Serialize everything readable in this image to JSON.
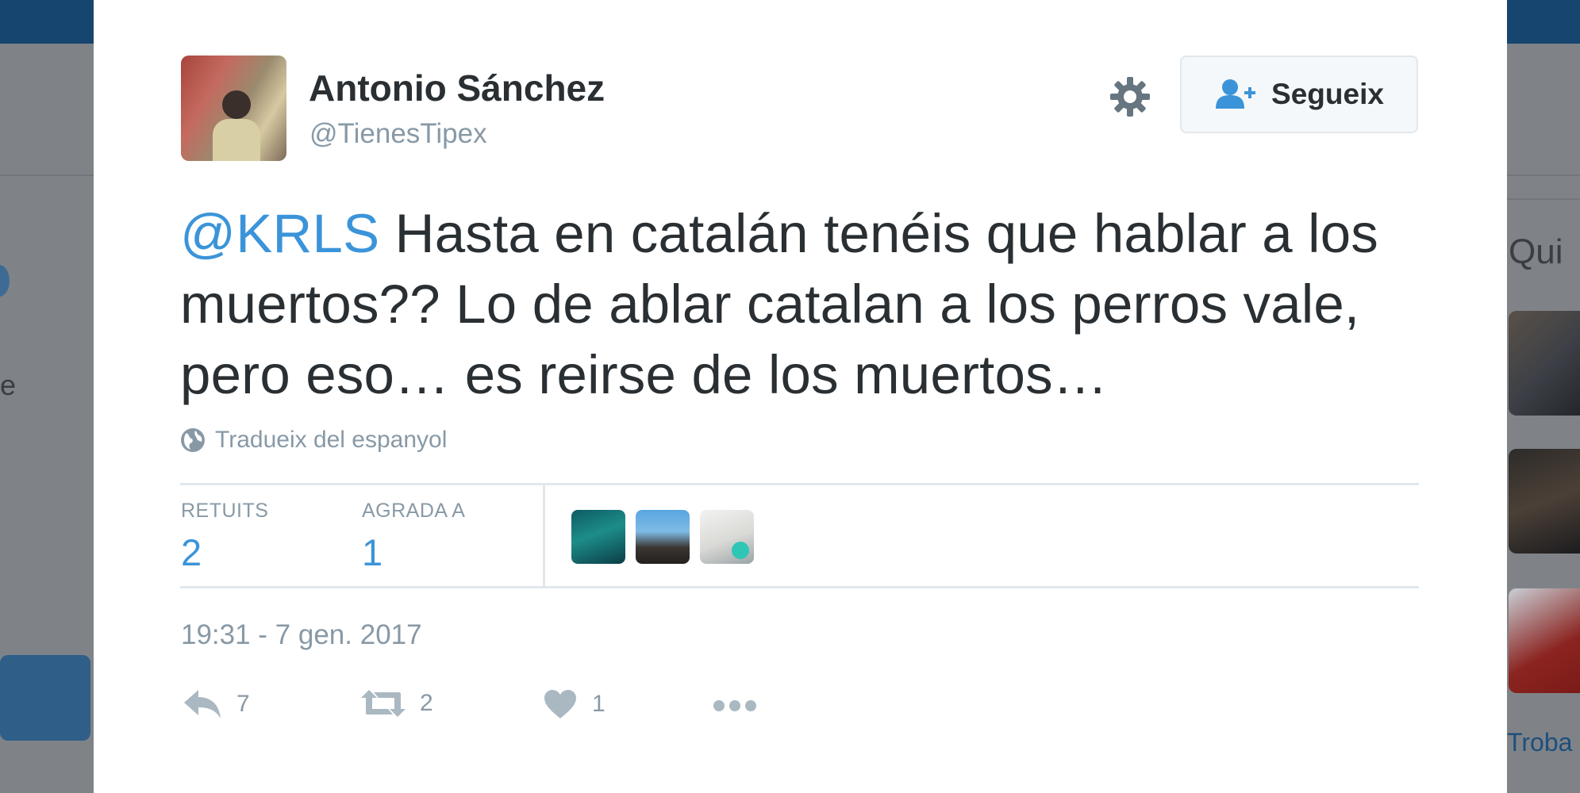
{
  "background": {
    "left_letter": "e",
    "right_heading": "Qui",
    "right_link": "Troba"
  },
  "tweet": {
    "author": {
      "name": "Antonio Sánchez",
      "handle": "@TienesTipex"
    },
    "follow_label": "Segueix",
    "mention": "@KRLS",
    "text": " Hasta en catalán tenéis que hablar a los muertos?? Lo de ablar catalan a los perros vale, pero eso… es reirse de los muertos…",
    "translate_label": "Tradueix del espanyol",
    "stats": {
      "retweets_label": "RETUITS",
      "retweets_value": "2",
      "likes_label": "AGRADA A",
      "likes_value": "1"
    },
    "timestamp": "19:31 - 7 gen. 2017",
    "actions": {
      "reply_count": "7",
      "retweet_count": "2",
      "like_count": "1"
    }
  },
  "colors": {
    "accent": "#3b94d9",
    "text": "#292f33",
    "muted": "#8899a6",
    "overlay": "#7f8388",
    "topbar": "#16456f"
  },
  "icons": [
    "gear-icon",
    "follow-user-icon",
    "globe-icon",
    "reply-icon",
    "retweet-icon",
    "heart-icon",
    "more-icon"
  ]
}
